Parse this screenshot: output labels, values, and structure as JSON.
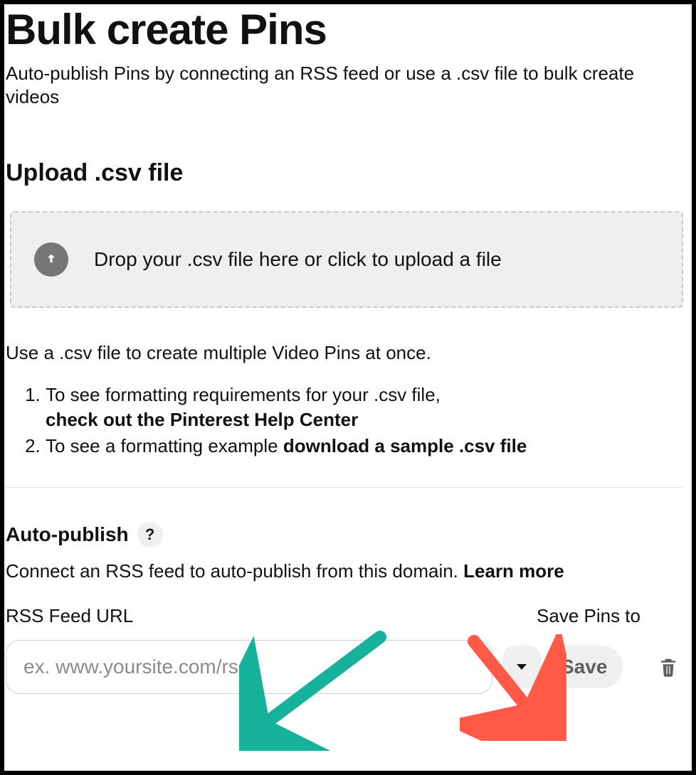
{
  "header": {
    "title": "Bulk create Pins",
    "subtitle": "Auto-publish Pins by connecting an RSS feed or use a .csv file to bulk create videos"
  },
  "upload": {
    "heading": "Upload .csv file",
    "dropzone_text": "Drop your .csv file here or click to upload a file",
    "lead": "Use a .csv file to create multiple Video Pins at once.",
    "items": [
      {
        "text": "To see formatting requirements for your .csv file, ",
        "bold": "check out the Pinterest Help Center"
      },
      {
        "text": "To see a formatting example ",
        "bold": "download a sample .csv file"
      }
    ]
  },
  "autopublish": {
    "heading": "Auto-publish",
    "help_glyph": "?",
    "description": "Connect an RSS feed to auto-publish from this domain. ",
    "learn_more": "Learn more",
    "rss_label": "RSS Feed URL",
    "save_to_label": "Save Pins to",
    "rss_placeholder": "ex. www.yoursite.com/rss",
    "rss_value": "",
    "save_button": "Save"
  },
  "icons": {
    "upload": "upload-icon",
    "help": "help-icon",
    "chevron_down": "chevron-down-icon",
    "trash": "trash-icon"
  }
}
